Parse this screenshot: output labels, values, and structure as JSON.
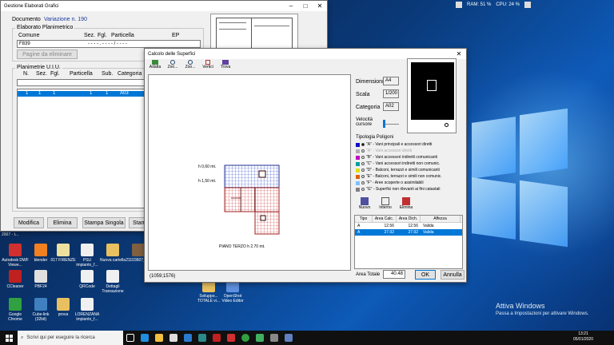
{
  "tray": {
    "ram": "RAM: 51 %",
    "cpu": "CPU: 24 %"
  },
  "back_window": {
    "title": "Gestione Elaborati Grafici",
    "documento_label": "Documento",
    "documento_value": "Variazione n. 190",
    "elaborato_label": "Elaborato Planimetrico",
    "cols": {
      "comune": "Comune",
      "sez": "Sez.",
      "fgl": "Fgl.",
      "particella": "Particella",
      "ep": "EP"
    },
    "comune_value": "F839",
    "particella_value": "- - - - . - - - - / - - - -",
    "pagine_btn": "Pagine da eliminare",
    "planimetrie_label": "Planimetrie U.I.U.",
    "plan_cols": {
      "n": "N.",
      "sez": "Sez.",
      "fgl": "Fgl.",
      "particella": "Particella",
      "sub": "Sub.",
      "categoria": "Categoria"
    },
    "row": {
      "n": "1",
      "sez": "1",
      "fgl": "1",
      "particella": "1",
      "sub": "1",
      "categoria": "A03"
    },
    "buttons": {
      "modifica": "Modifica",
      "elimina": "Elimina",
      "stampa": "Stampa Singola",
      "stam": "Stam"
    }
  },
  "main_window": {
    "title": "Calcolo delle Superfici",
    "toolbar": {
      "adatta": "Adatta",
      "zoom_in": "Zoo...",
      "zoom_out": "Zoo...",
      "vertici": "Vertici",
      "trova": "Trova"
    },
    "plan_labels": {
      "h060": "h 0,60 mt.",
      "h150": "h 1,50 mt.",
      "cucina": "cucina",
      "piano": "PIANO TERZO h 2.70 mt."
    },
    "coords": "(1059;1576)",
    "dimensioni_label": "Dimensioni",
    "dimensioni_value": "A4",
    "scala_label": "Scala",
    "scala_value": "1/200",
    "categoria_label": "Categoria",
    "categoria_value": "A02",
    "velocita_label": "Velocità cursore",
    "tipologia_label": "Tipologia Poligoni",
    "tipologie": [
      {
        "text": "\"A\" - Vani principali e accessori diretti",
        "color": "#1010c0",
        "checked": true,
        "disabled": false
      },
      {
        "text": "\"A\" - Vani accessori diretti",
        "color": "#b0b0b0",
        "checked": false,
        "disabled": true
      },
      {
        "text": "\"B\" - Vani accessori indiretti comunicanti",
        "color": "#c000c0",
        "checked": false,
        "disabled": false
      },
      {
        "text": "\"C\" - Vani accessori indiretti non comunic.",
        "color": "#00a0a0",
        "checked": false,
        "disabled": false
      },
      {
        "text": "\"D\" - Balconi, terrazzi e simili comunicanti",
        "color": "#e0e000",
        "checked": false,
        "disabled": false
      },
      {
        "text": "\"E\" - Balconi, terrazzi e simili non comunic.",
        "color": "#e06000",
        "checked": false,
        "disabled": false
      },
      {
        "text": "\"F\" - Aree scoperte o assimilabili",
        "color": "#80c0ff",
        "checked": false,
        "disabled": false
      },
      {
        "text": "\"G\" - Superfici non rilevanti ai fini catastali",
        "color": "#808080",
        "checked": false,
        "disabled": false
      }
    ],
    "actions": {
      "nuovo": "Nuovo",
      "interno": "Interno",
      "elimina": "Elimina"
    },
    "table": {
      "headers": [
        "Tipo",
        "Area Calc.",
        "Area Dich.",
        "Affezza"
      ],
      "rows": [
        {
          "tipo": "A",
          "calc": "12.56",
          "dich": "12.56",
          "aff": "Valida"
        },
        {
          "tipo": "A",
          "calc": "27.92",
          "dich": "27.92",
          "aff": "Valida"
        }
      ]
    },
    "area_totale_label": "Area Totale",
    "area_totale_value": "40.48",
    "ok": "OK",
    "annulla": "Annulla"
  },
  "desktop_icons": [
    {
      "label": "Autodesk DWF Viewe...",
      "color": "#d03030"
    },
    {
      "label": "blender",
      "color": "#f08020"
    },
    {
      "label": "017 FIRENZE",
      "color": "#f0e0a0"
    },
    {
      "label": "PSU impianto_f...",
      "color": "#f0f0f0"
    },
    {
      "label": "Nuova cartella",
      "color": "#e8c060"
    },
    {
      "label": "21103607_1...",
      "color": "#806040"
    },
    {
      "label": "CCleaner",
      "color": "#c02020"
    },
    {
      "label": "PBF24",
      "color": "#e0e0e0"
    },
    {
      "label": "QRCode",
      "color": "#f0f0f0"
    },
    {
      "label": "Dettagli Transazione",
      "color": "#f0f0f0"
    },
    {
      "label": "Google Chrome",
      "color": "#30a040"
    },
    {
      "label": "Cube-link (32bit)",
      "color": "#4080c0"
    },
    {
      "label": "prova",
      "color": "#e8c060"
    },
    {
      "label": "LORENZANA impianto_f...",
      "color": "#f0f0f0"
    },
    {
      "label": "Sviluppo... TOTALE vi...",
      "color": "#e8c060"
    },
    {
      "label": "OpenShot Video Editor",
      "color": "#6090e0"
    }
  ],
  "partial_label": "2007 - t...",
  "activate": {
    "line1": "Attiva Windows",
    "line2": "Passa a Impostazioni per attivare Windows."
  },
  "taskbar": {
    "search_placeholder": "Scrivi qui per eseguire la ricerca",
    "time": "13:21",
    "date": "05/01/2020"
  }
}
